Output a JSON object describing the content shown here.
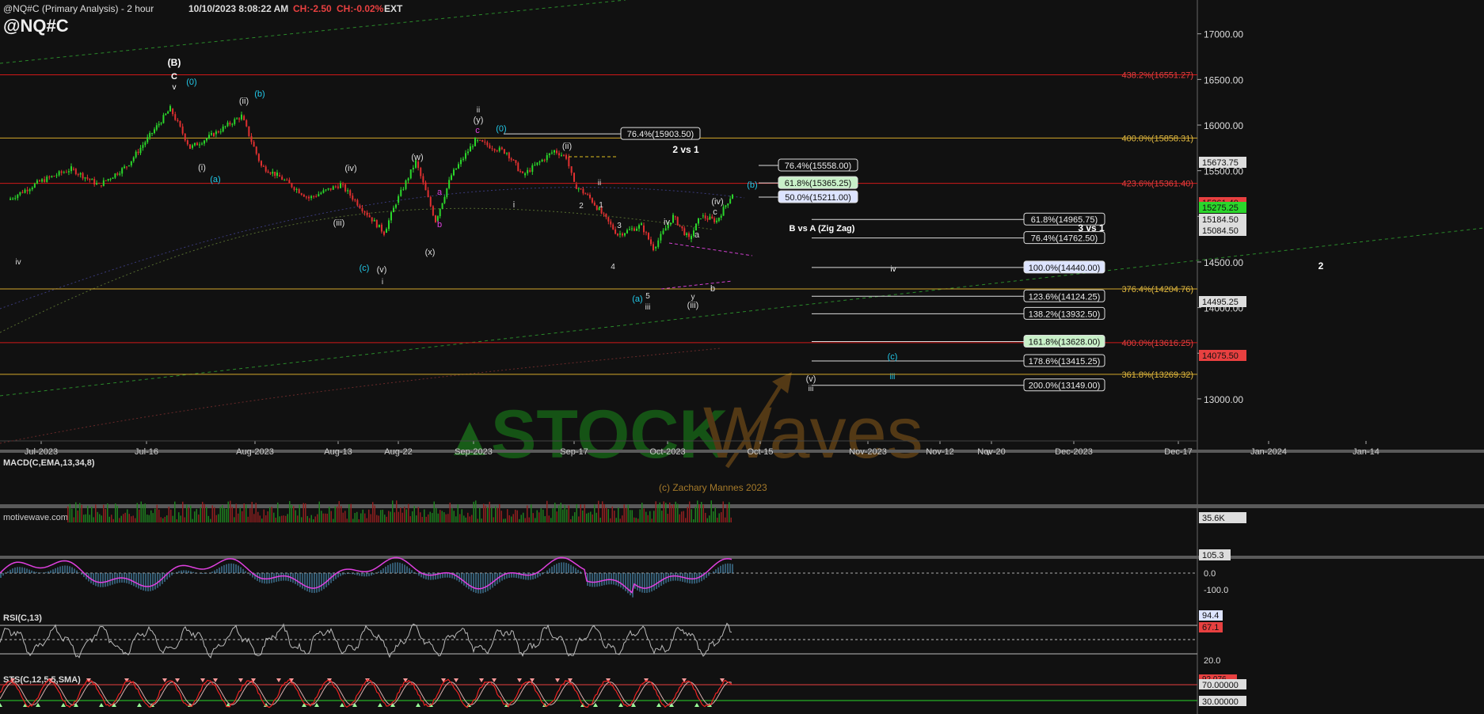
{
  "header": {
    "title": "@NQ#C (Primary Analysis) - 2 hour",
    "datetime": "10/10/2023 8:08:22 AM",
    "change": "CH:-2.50",
    "change_pct": "CH:-0.02%",
    "session": "EXT",
    "symbol": "@NQ#C"
  },
  "watermark": {
    "brand_left": "STOCK",
    "brand_right": "Waves",
    "copyright": "(c) Zachary Mannes 2023",
    "site": "motivewave.com"
  },
  "colors": {
    "background": "#111111",
    "up_candle": "#2bd62b",
    "down_candle": "#e03030",
    "red_line": "#d01818",
    "gold_line": "#d4a82a",
    "green_dashed": "#2a8a2a",
    "macd": "#e040e0",
    "rsi": "#bbbbbb",
    "stoch_fast": "#ee2222",
    "accent_cyan": "#22c8e8"
  },
  "chart_data": [
    {
      "type": "candlestick",
      "title": "@NQ#C (Primary Analysis) - 2 hour",
      "x_ticks": [
        "Jul-2023",
        "Jul-16",
        "Aug-2023",
        "Aug-13",
        "Aug-22",
        "Sep-2023",
        "Sep-17",
        "Oct-2023",
        "Oct-15",
        "Nov-2023",
        "Nov-12",
        "Nov-20",
        "Dec-2023",
        "Dec-17",
        "Jan-2024",
        "Jan-14"
      ],
      "y_ticks": [
        13000,
        13500,
        14000,
        14500,
        15000,
        15500,
        16000,
        16500,
        17000
      ],
      "ylim": [
        12880,
        17100
      ],
      "price_path": {
        "dates": [
          "Jun-28",
          "Jul-1",
          "Jul-5",
          "Jul-8",
          "Jul-12",
          "Jul-16",
          "Jul-19",
          "Jul-22",
          "Jul-26",
          "Jul-31",
          "Aug-3",
          "Aug-6",
          "Aug-10",
          "Aug-13",
          "Aug-17",
          "Aug-20",
          "Aug-23",
          "Aug-26",
          "Aug-29",
          "Sep-1",
          "Sep-5",
          "Sep-9",
          "Sep-13",
          "Sep-15",
          "Sep-17",
          "Sep-19",
          "Sep-22",
          "Sep-25",
          "Sep-28",
          "Oct-1",
          "Oct-4",
          "Oct-6",
          "Oct-8",
          "Oct-10"
        ],
        "values": [
          15180,
          15380,
          15520,
          15340,
          15550,
          15950,
          16180,
          15750,
          15900,
          16100,
          15550,
          15450,
          15200,
          15350,
          14820,
          15150,
          15600,
          14950,
          15450,
          15830,
          15700,
          15450,
          15720,
          15650,
          15350,
          15200,
          14800,
          14900,
          14650,
          15000,
          14750,
          15000,
          14950,
          15250
        ]
      },
      "price_labels": [
        {
          "value": "15673.75",
          "color": "#dddddd"
        },
        {
          "value": "15361.40",
          "color": "#e84040"
        },
        {
          "value": "15275.25",
          "color": "#2bd62b"
        },
        {
          "value": "15184.50",
          "color": "#dddddd"
        },
        {
          "value": "15084.50",
          "color": "#dddddd"
        },
        {
          "value": "14495.25",
          "color": "#dddddd"
        },
        {
          "value": "14075.50",
          "color": "#e84040"
        },
        {
          "value": "35.6K",
          "color": "#dddddd"
        }
      ],
      "horizontal_levels": [
        {
          "price": 16551.27,
          "label": "438.2%(16551.27)",
          "color": "#d01818"
        },
        {
          "price": 15858.31,
          "label": "400.0%(15858.31)",
          "color": "#d4a82a"
        },
        {
          "price": 15361.4,
          "label": "423.6%(15361.40)",
          "color": "#d01818"
        },
        {
          "price": 14204.76,
          "label": "376.4%(14204.76)",
          "color": "#d4a82a"
        },
        {
          "price": 13616.25,
          "label": "400.0%(13616.25)",
          "color": "#d01818"
        },
        {
          "price": 13269.32,
          "label": "361.8%(13269.32)",
          "color": "#d4a82a"
        }
      ],
      "fib_boxes": [
        {
          "label": "76.4%(15903.50)",
          "price": 15903.5,
          "bg": "#111111"
        },
        {
          "label": "76.4%(15558.00)",
          "price": 15558.0,
          "bg": "#111111"
        },
        {
          "label": "61.8%(15365.25)",
          "price": 15365.25,
          "bg": "#c8f0c8"
        },
        {
          "label": "50.0%(15211.00)",
          "price": 15211.0,
          "bg": "#dde4ff"
        },
        {
          "label": "61.8%(14965.75)",
          "price": 14965.75,
          "bg": "#111111"
        },
        {
          "label": "76.4%(14762.50)",
          "price": 14762.5,
          "bg": "#111111"
        },
        {
          "label": "100.0%(14440.00)",
          "price": 14440.0,
          "bg": "#dde4ff"
        },
        {
          "label": "123.6%(14124.25)",
          "price": 14124.25,
          "bg": "#111111"
        },
        {
          "label": "138.2%(13932.50)",
          "price": 13932.5,
          "bg": "#111111"
        },
        {
          "label": "161.8%(13628.00)",
          "price": 13628.0,
          "bg": "#c8f0c8"
        },
        {
          "label": "178.6%(13415.25)",
          "price": 13415.25,
          "bg": "#111111"
        },
        {
          "label": "200.0%(13149.00)",
          "price": 13149.0,
          "bg": "#111111"
        }
      ],
      "annotations": [
        "(B)",
        "C",
        "v",
        "(0)",
        "(ii)",
        "(b)",
        "(i)",
        "(a)",
        "(iv)",
        "(iii)",
        "(w)",
        "a",
        "b",
        "(x)",
        "(c)",
        "(v)",
        "i",
        "ii",
        "(y)",
        "c",
        "(0)",
        "(ii)",
        "i",
        "ii",
        "1",
        "2",
        "3",
        "4",
        "5",
        "iv",
        "a",
        "y",
        "(iii)",
        "(iv)",
        "c",
        "b",
        "(a)",
        "iii",
        "(b)",
        "2 vs 1",
        "B vs A (Zig Zag)",
        "3 vs 1",
        "iv",
        "(c)",
        "iii",
        "(v)",
        "iii",
        "v",
        "2",
        "iv"
      ]
    },
    {
      "type": "line",
      "title": "MACD(C,EMA,13,34,8)",
      "y_ticks": [
        100.0,
        0.0,
        -100.0
      ],
      "last_value": "105.3"
    },
    {
      "type": "line",
      "title": "RSI(C,13)",
      "y_ticks": [
        20.0
      ],
      "last_values": [
        "94.4",
        "67.1"
      ]
    },
    {
      "type": "line",
      "title": "STS(C,12,5,5,SMA)",
      "y_ticks": [
        70.0,
        30.0
      ],
      "last_values": [
        "92.076",
        "70.00000",
        "30.00000"
      ]
    }
  ]
}
